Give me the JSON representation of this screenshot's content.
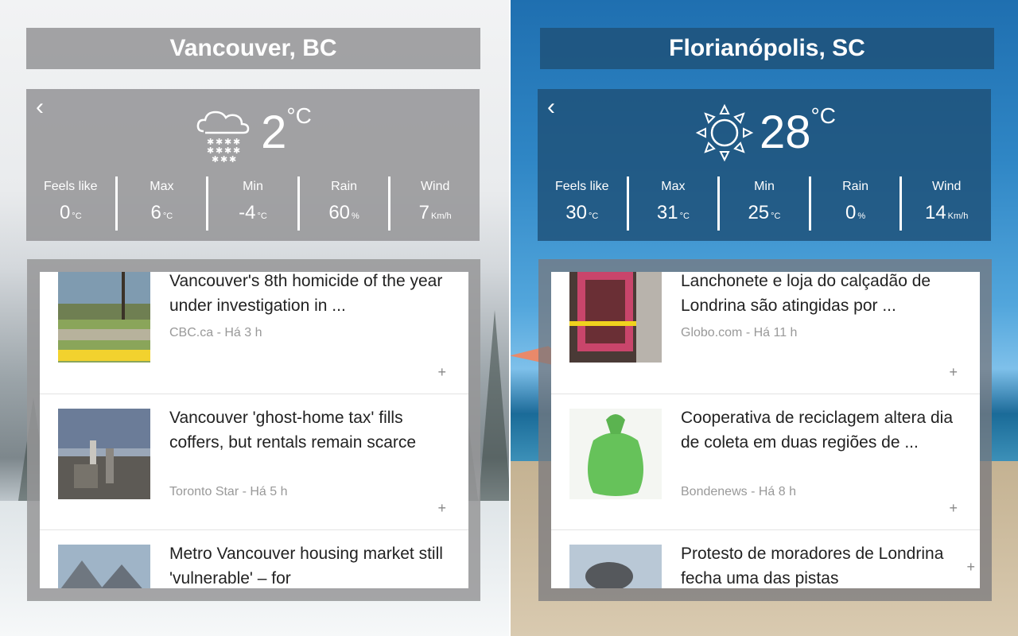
{
  "left": {
    "city": "Vancouver, BC",
    "back_icon": "chevron-left-icon",
    "weather_icon": "cloud-snow-icon",
    "temp": "2",
    "temp_unit": "°C",
    "stats": [
      {
        "label": "Feels like",
        "value": "0",
        "unit": "°C"
      },
      {
        "label": "Max",
        "value": "6",
        "unit": "°C"
      },
      {
        "label": "Min",
        "value": "-4",
        "unit": "°C"
      },
      {
        "label": "Rain",
        "value": "60",
        "unit": "%"
      },
      {
        "label": "Wind",
        "value": "7",
        "unit": "Km/h"
      }
    ],
    "news": [
      {
        "headline": "Vancouver's 8th homicide of the year under investigation in ...",
        "source": "CBC.ca - Há 3 h"
      },
      {
        "headline": "Vancouver 'ghost-home tax' fills coffers, but rentals remain scarce",
        "source": "Toronto Star - Há 5 h"
      },
      {
        "headline": "Metro Vancouver housing market still 'vulnerable' – for",
        "source": ""
      }
    ]
  },
  "right": {
    "city": "Florianópolis, SC",
    "back_icon": "chevron-left-icon",
    "weather_icon": "sun-icon",
    "temp": "28",
    "temp_unit": "°C",
    "stats": [
      {
        "label": "Feels like",
        "value": "30",
        "unit": "°C"
      },
      {
        "label": "Max",
        "value": "31",
        "unit": "°C"
      },
      {
        "label": "Min",
        "value": "25",
        "unit": "°C"
      },
      {
        "label": "Rain",
        "value": "0",
        "unit": "%"
      },
      {
        "label": "Wind",
        "value": "14",
        "unit": "Km/h"
      }
    ],
    "news": [
      {
        "headline": "Lanchonete e loja do calçadão de Londrina são atingidas por ...",
        "source": "Globo.com - Há 11 h"
      },
      {
        "headline": "Cooperativa de reciclagem altera dia de coleta em duas regiões de ...",
        "source": "Bondenews - Há 8 h"
      },
      {
        "headline": "Protesto de moradores de Londrina fecha uma das pistas",
        "source": ""
      }
    ]
  },
  "news_action_icon": "plus-icon",
  "colors": {
    "card_gray": "#969698",
    "card_blue": "#1e5078",
    "text_white": "#ffffff",
    "source_gray": "#999999"
  }
}
